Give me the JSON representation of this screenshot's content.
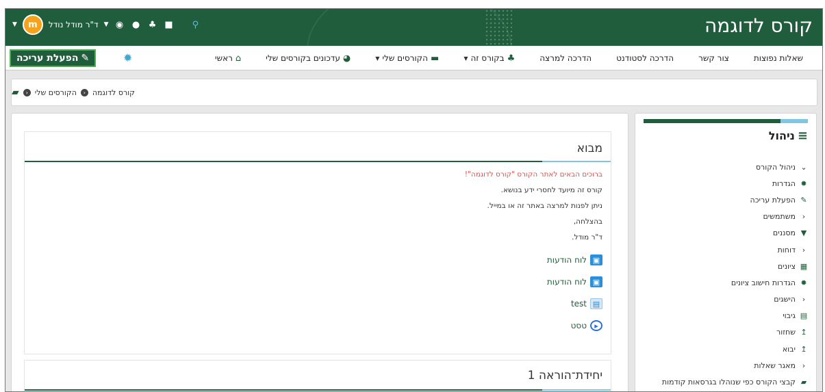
{
  "site": {
    "title": "קורס לדוגמה"
  },
  "user": {
    "name": "ד\"ר מודל נודל",
    "avatar_initials": "m"
  },
  "topbar_icons": [
    "video-icon",
    "bell-icon",
    "chat-icon",
    "globe-icon",
    "search-icon"
  ],
  "navbar": {
    "items": [
      {
        "icon": "home-icon",
        "label": "ראשי",
        "dropdown": false
      },
      {
        "icon": "tachometer-icon",
        "label": "עדכונים בקורסים שלי",
        "dropdown": false
      },
      {
        "icon": "briefcase-icon",
        "label": "הקורסים שלי",
        "dropdown": true
      },
      {
        "icon": "sitemap-icon",
        "label": "בקורס זה",
        "dropdown": true
      },
      {
        "icon": "",
        "label": "הדרכה למרצה",
        "dropdown": false
      },
      {
        "icon": "",
        "label": "הדרכה לסטודנט",
        "dropdown": false
      },
      {
        "icon": "",
        "label": "צור קשר",
        "dropdown": false
      },
      {
        "icon": "",
        "label": "שאלות נפוצות",
        "dropdown": false
      }
    ],
    "edit_button": "הפעלת עריכה"
  },
  "breadcrumb": {
    "items": [
      "הקורסים שלי",
      "קורס לדוגמה"
    ]
  },
  "sidebar": {
    "title": "ניהול",
    "items": [
      {
        "icon": "chevron-down",
        "label": "ניהול הקורס"
      },
      {
        "icon": "gear",
        "label": "הגדרות"
      },
      {
        "icon": "pencil",
        "label": "הפעלת עריכה"
      },
      {
        "icon": "chevron-left",
        "label": "משתמשים"
      },
      {
        "icon": "filter",
        "label": "מסננים"
      },
      {
        "icon": "chevron-left",
        "label": "דוחות"
      },
      {
        "icon": "table",
        "label": "ציונים"
      },
      {
        "icon": "gear",
        "label": "הגדרות חישוב ציונים"
      },
      {
        "icon": "chevron-left",
        "label": "הישגים"
      },
      {
        "icon": "file",
        "label": "גיבוי"
      },
      {
        "icon": "upload",
        "label": "שחזור"
      },
      {
        "icon": "upload",
        "label": "יבוא"
      },
      {
        "icon": "chevron-left",
        "label": "מאגר שאלות"
      },
      {
        "icon": "folder",
        "label": "קבצי הקורס כפי שנוהלו בגרסאות קודמות"
      }
    ]
  },
  "intro": {
    "title": "מבוא",
    "welcome": "ברוכים הבאים לאתר הקורס \"קורס לדוגמה\"!",
    "lines": [
      "קורס זה מיועד לחסרי ידע בנושא.",
      "ניתן לפנות למרצה באתר זה או במייל.",
      "בהצלחה,",
      "ד\"ר מודל."
    ],
    "activities": [
      {
        "type": "forum",
        "label": "לוח הודעות"
      },
      {
        "type": "forum",
        "label": "לוח הודעות"
      },
      {
        "type": "page",
        "label": "test"
      },
      {
        "type": "quiz",
        "label": "טסט"
      }
    ]
  },
  "unit1": {
    "title": "יחידת־הוראה 1"
  },
  "colors": {
    "brand": "#1f5d3c",
    "accent": "#7fc6e4",
    "welcome_red": "#d9534f"
  }
}
